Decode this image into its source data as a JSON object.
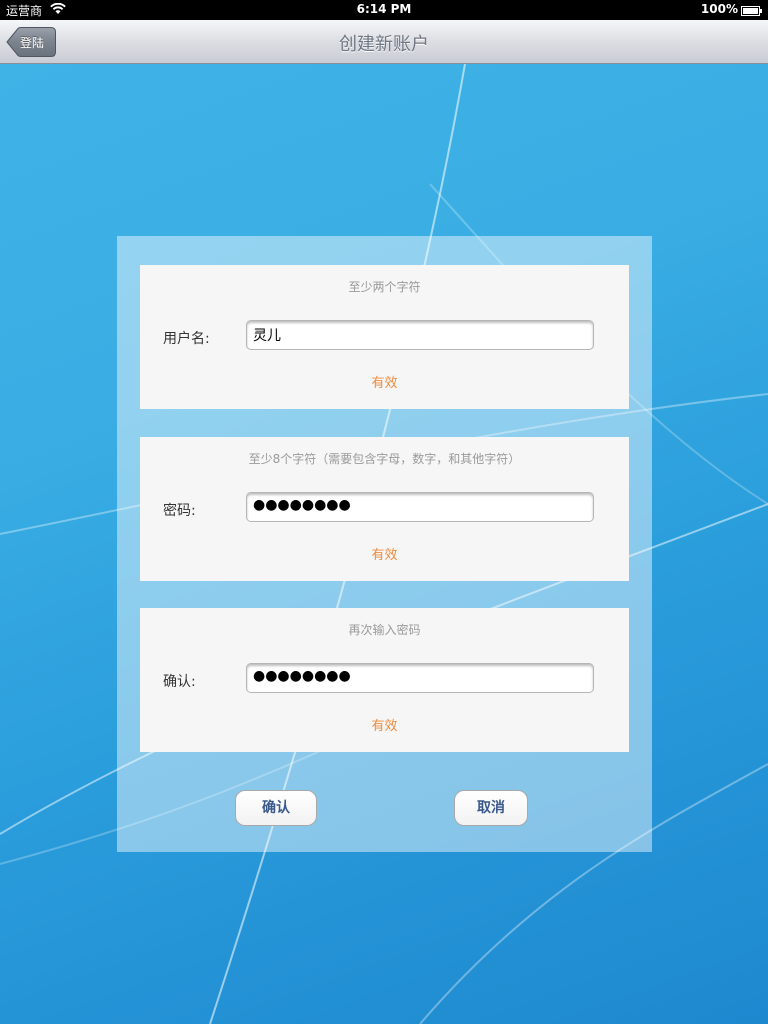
{
  "status_bar": {
    "carrier": "运营商",
    "time": "6:14 PM",
    "battery": "100%"
  },
  "nav_bar": {
    "back_label": "登陆",
    "title": "创建新账户"
  },
  "form": {
    "username": {
      "hint": "至少两个字符",
      "label": "用户名:",
      "value": "灵儿",
      "status": "有效"
    },
    "password": {
      "hint": "至少8个字符（需要包含字母，数字，和其他字符）",
      "label": "密码:",
      "value": "●●●●●●●●",
      "status": "有效"
    },
    "confirm": {
      "hint": "再次输入密码",
      "label": "确认:",
      "value": "●●●●●●●●",
      "status": "有效"
    }
  },
  "buttons": {
    "confirm": "确认",
    "cancel": "取消"
  },
  "icons": {
    "wifi": "wifi-icon",
    "battery": "battery-icon",
    "back": "back-arrow-icon"
  },
  "colors": {
    "valid": "#f08a3c",
    "button_text": "#3b5a8c",
    "background": "#2a9ddc"
  }
}
